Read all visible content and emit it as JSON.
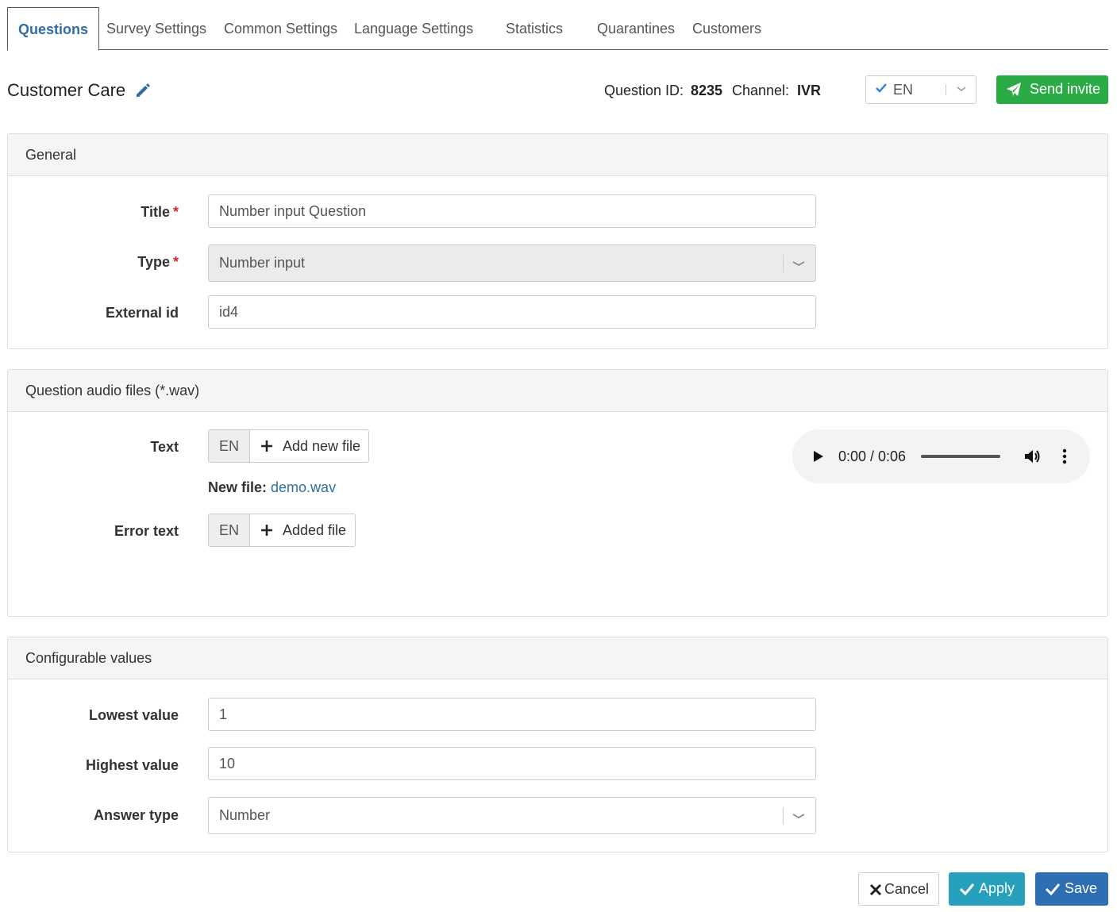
{
  "tabs": [
    {
      "label": "Questions",
      "active": true
    },
    {
      "label": "Survey Settings"
    },
    {
      "label": "Common Settings"
    },
    {
      "label": "Language Settings"
    },
    {
      "label": "Statistics"
    },
    {
      "label": "Quarantines"
    },
    {
      "label": "Customers"
    }
  ],
  "header": {
    "title": "Customer Care",
    "question_id_label": "Question ID:",
    "question_id_value": "8235",
    "channel_label": "Channel:",
    "channel_value": "IVR",
    "language": "EN",
    "send_invite_label": "Send invite"
  },
  "general": {
    "heading": "General",
    "title_label": "Title",
    "title_value": "Number input Question",
    "type_label": "Type",
    "type_value": "Number input",
    "external_id_label": "External id",
    "external_id_value": "id4",
    "required_mark": "*"
  },
  "audio_files": {
    "heading": "Question audio files (*.wav)",
    "text_label": "Text",
    "text_lang": "EN",
    "text_button": "Add new file",
    "new_file_label": "New file:",
    "new_file_name": "demo.wav",
    "error_text_label": "Error text",
    "error_text_lang": "EN",
    "error_text_button": "Added file",
    "player_time": "0:00 / 0:06"
  },
  "configurable": {
    "heading": "Configurable values",
    "lowest_label": "Lowest value",
    "lowest_value": "1",
    "highest_label": "Highest value",
    "highest_value": "10",
    "answer_type_label": "Answer type",
    "answer_type_value": "Number"
  },
  "footer": {
    "cancel_label": "Cancel",
    "apply_label": "Apply",
    "save_label": "Save"
  },
  "colors": {
    "accent": "#2f6ea5",
    "send": "#2bab45",
    "apply": "#27a0bd",
    "save": "#2e6eb3",
    "required": "#d9262c"
  }
}
